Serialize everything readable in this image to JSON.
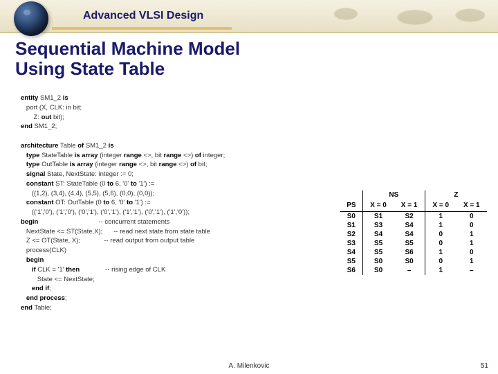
{
  "header": {
    "course_title": "Advanced VLSI Design"
  },
  "slide": {
    "title_l1": "Sequential Machine Model",
    "title_l2": "Using State Table"
  },
  "code": {
    "l01a": "entity",
    "l01b": " SM1_2 ",
    "l01c": "is",
    "l02": "   port (X, CLK: in bit;",
    "l03a": "       Z: ",
    "l03b": "out",
    "l03c": " bit);",
    "l04a": "end",
    "l04b": " SM1_2;",
    "l05": "",
    "l06a": "architecture",
    "l06b": " Table ",
    "l06c": "of",
    "l06d": " SM1_2 ",
    "l06e": "is",
    "l07a": "   type",
    "l07b": " StateTable ",
    "l07c": "is array",
    "l07d": " (integer ",
    "l07e": "range",
    "l07f": " <>, bit ",
    "l07g": "range",
    "l07h": " <>) ",
    "l07i": "of",
    "l07j": " integer;",
    "l08a": "   type",
    "l08b": " OutTable ",
    "l08c": "is array",
    "l08d": " (integer ",
    "l08e": "range",
    "l08f": " <>, bit ",
    "l08g": "range",
    "l08h": " <>) ",
    "l08i": "of",
    "l08j": " bit;",
    "l09a": "   signal",
    "l09b": " State, NextState: integer := 0;",
    "l10a": "   constant",
    "l10b": " ST: StateTable (0 ",
    "l10c": "to",
    "l10d": " 6, '0' ",
    "l10e": "to",
    "l10f": " '1') :=",
    "l11": "      ((1,2), (3,4), (4,4), (5,5), (5,6), (0,0), (0,0));",
    "l12a": "   constant",
    "l12b": " OT: OutTable (0 ",
    "l12c": "to",
    "l12d": " 6, '0' ",
    "l12e": "to",
    "l12f": " '1') :=",
    "l13": "      (('1','0'), ('1','0'), ('0','1'), ('0','1'), ('1','1'), ('0','1'), ('1','0'));",
    "l14": "begin",
    "l14c": "                                 -- concurrent statements",
    "l15": "   NextState <= ST(State,X);      -- read next state from state table",
    "l16": "   Z <= OT(State, X);             -- read output from output table",
    "l17": "   process(CLK)",
    "l18": "   begin",
    "l19a": "      if",
    "l19b": " CLK = '1' ",
    "l19c": "then",
    "l19d": "              -- rising edge of CLK",
    "l20": "         State <= NextState;",
    "l21a": "      end if",
    "l21b": ";",
    "l22a": "   end process",
    "l22b": ";",
    "l23a": "end",
    "l23b": " Table;"
  },
  "table": {
    "h_ns": "NS",
    "h_z": "Z",
    "h_ps": "PS",
    "h_x0": "X = 0",
    "h_x1": "X = 1",
    "rows": [
      {
        "ps": "S0",
        "ns0": "S1",
        "ns1": "S2",
        "z0": "1",
        "z1": "0"
      },
      {
        "ps": "S1",
        "ns0": "S3",
        "ns1": "S4",
        "z0": "1",
        "z1": "0"
      },
      {
        "ps": "S2",
        "ns0": "S4",
        "ns1": "S4",
        "z0": "0",
        "z1": "1"
      },
      {
        "ps": "S3",
        "ns0": "S5",
        "ns1": "S5",
        "z0": "0",
        "z1": "1"
      },
      {
        "ps": "S4",
        "ns0": "S5",
        "ns1": "S6",
        "z0": "1",
        "z1": "0"
      },
      {
        "ps": "S5",
        "ns0": "S0",
        "ns1": "S0",
        "z0": "0",
        "z1": "1"
      },
      {
        "ps": "S6",
        "ns0": "S0",
        "ns1": "–",
        "z0": "1",
        "z1": "–"
      }
    ]
  },
  "footer": {
    "copyright": " A. Milenkovic",
    "page": "51"
  }
}
